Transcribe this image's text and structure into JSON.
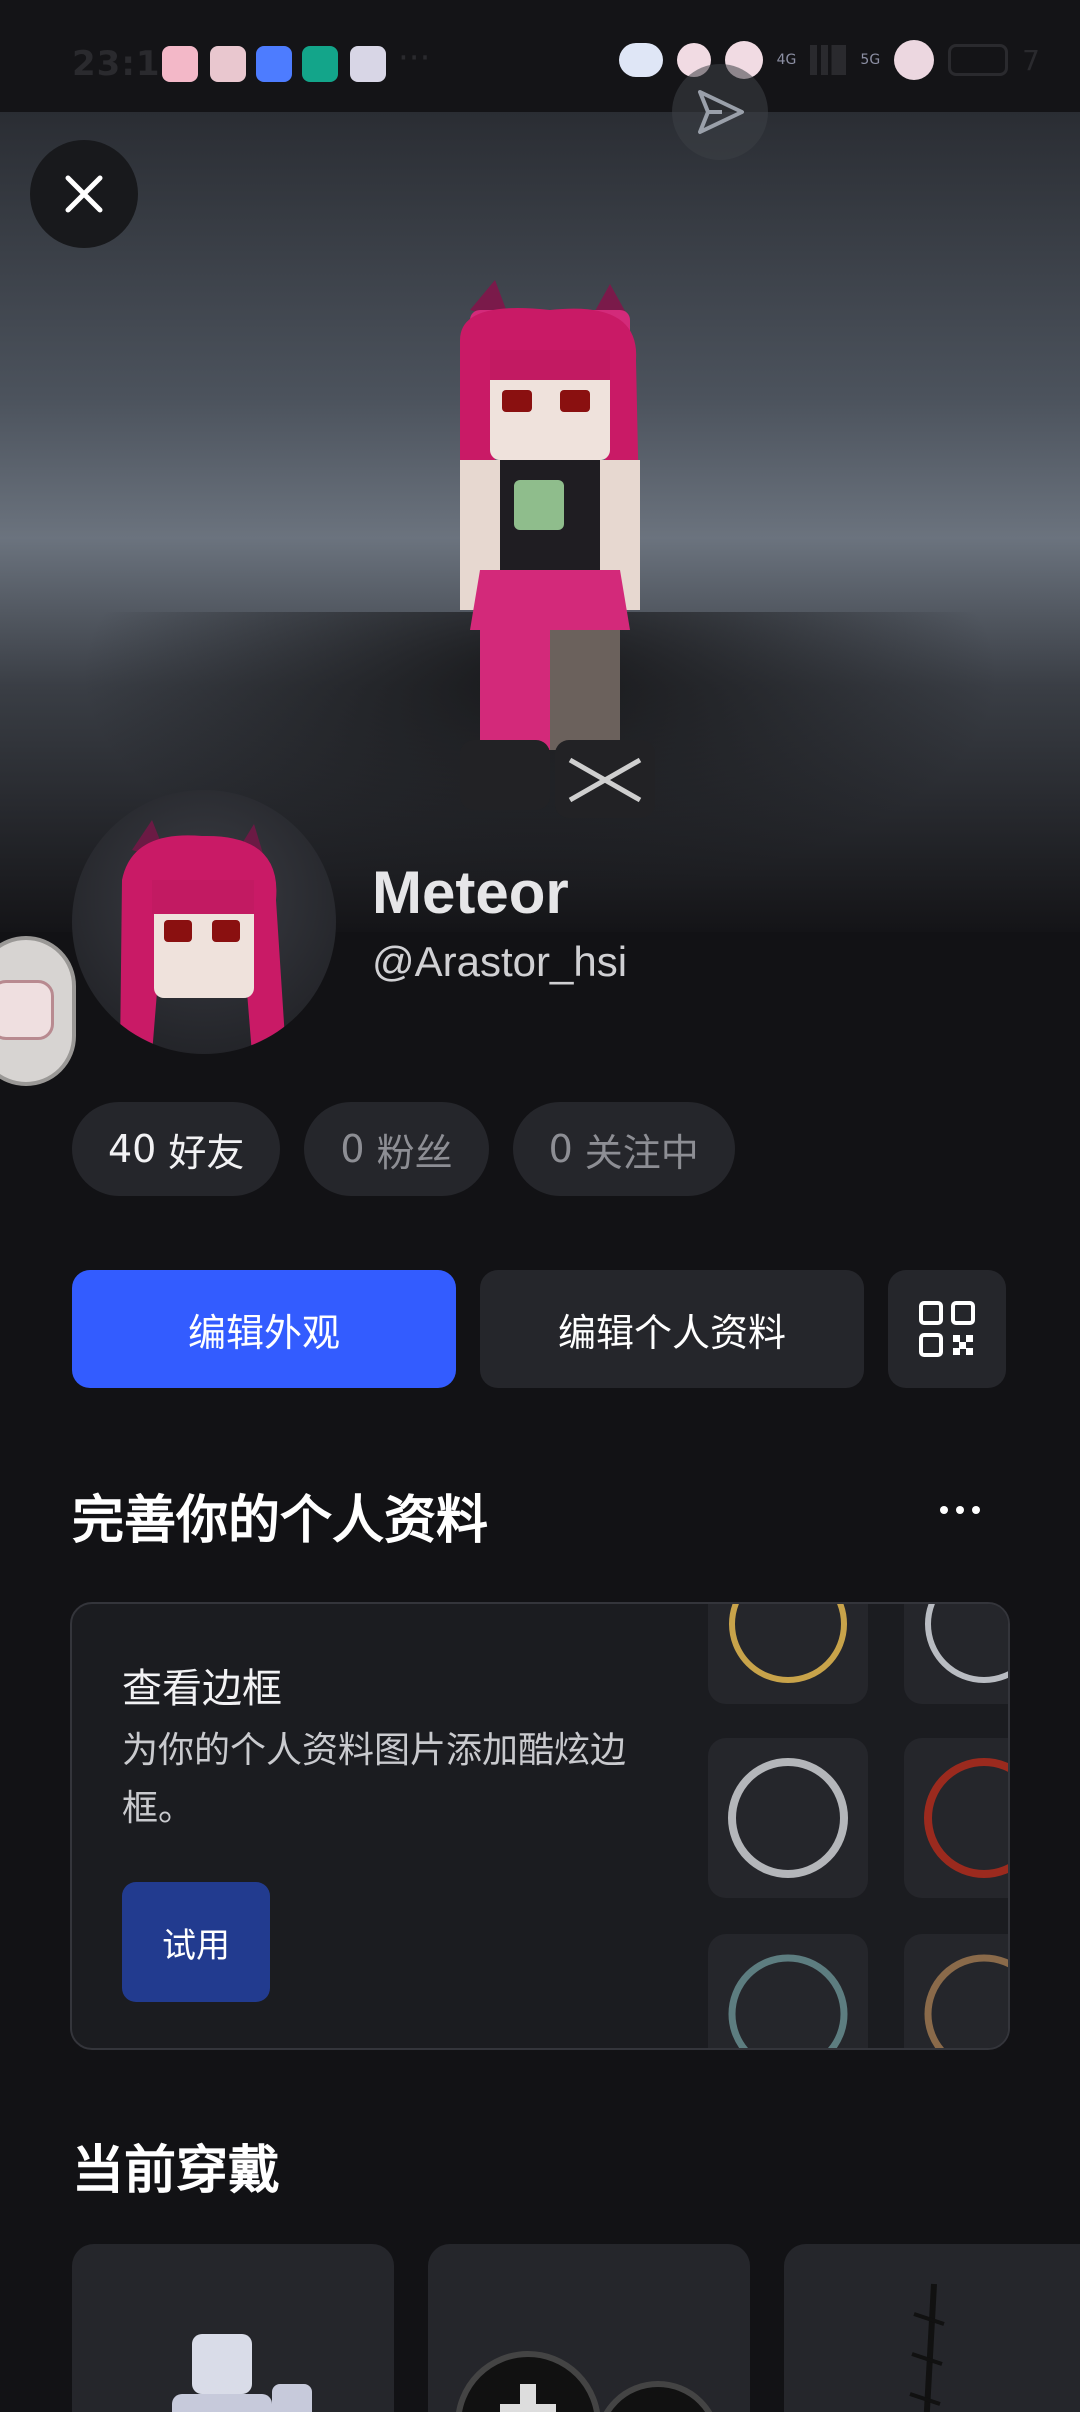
{
  "status_bar": {
    "time": "23:11",
    "network_1": "4G",
    "network_2": "5G",
    "battery": "7"
  },
  "profile": {
    "display_name": "Meteor",
    "username": "@Arastor_hsi"
  },
  "stats": [
    {
      "count": "40",
      "label": "好友"
    },
    {
      "count": "0",
      "label": "粉丝"
    },
    {
      "count": "0",
      "label": "关注中"
    }
  ],
  "actions": {
    "edit_appearance": "编辑外观",
    "edit_profile": "编辑个人资料"
  },
  "complete_profile": {
    "title": "完善你的个人资料",
    "card_title": "查看边框",
    "card_desc": "为你的个人资料图片添加酷炫边框。",
    "try_label": "试用"
  },
  "currently_wearing": {
    "title": "当前穿戴"
  },
  "colors": {
    "background": "#121215",
    "primary": "#335cff",
    "chip": "#25262b",
    "try_button": "#223b8f"
  },
  "icons": [
    "close-icon",
    "share-icon",
    "qr-code-icon",
    "more-icon"
  ]
}
